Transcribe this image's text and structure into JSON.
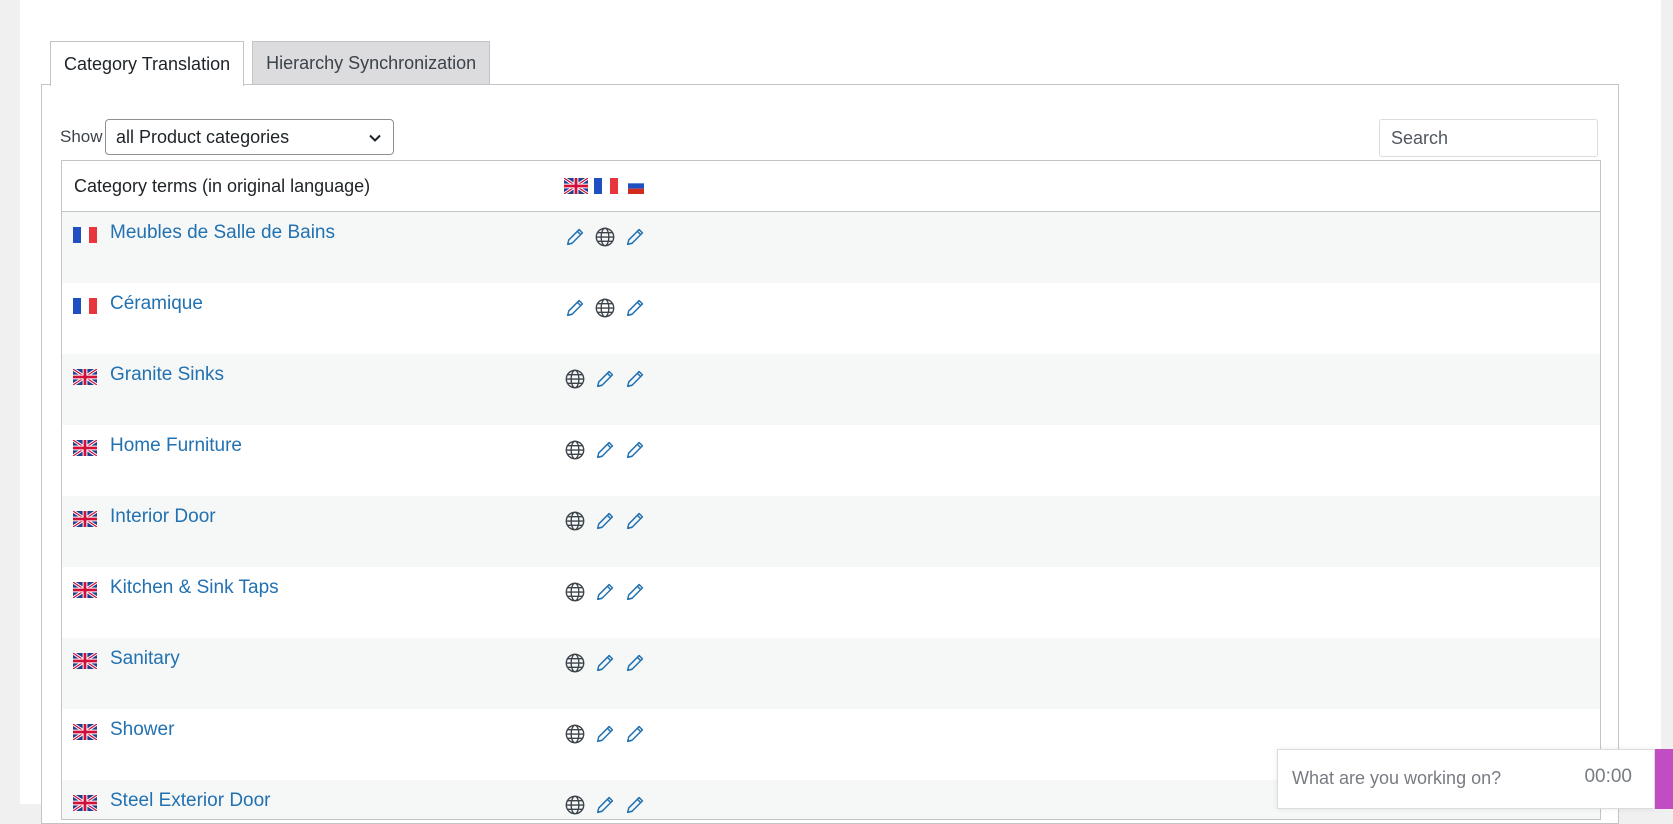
{
  "tabs": [
    {
      "label": "Category Translation",
      "active": true
    },
    {
      "label": "Hierarchy Synchronization",
      "active": false
    }
  ],
  "filter": {
    "show_label": "Show",
    "selected_option": "all Product categories",
    "search_placeholder": "Search"
  },
  "table": {
    "header": "Category terms (in original language)",
    "language_flags": [
      "gb-flag-icon",
      "fr-flag-icon",
      "ru-flag-icon"
    ],
    "rows": [
      {
        "name": "Meubles de Salle de Bains",
        "flag": "fr",
        "actions": [
          "pencil",
          "globe",
          "pencil"
        ]
      },
      {
        "name": "Céramique",
        "flag": "fr",
        "actions": [
          "pencil",
          "globe",
          "pencil"
        ]
      },
      {
        "name": "Granite Sinks",
        "flag": "gb",
        "actions": [
          "globe",
          "pencil",
          "pencil"
        ]
      },
      {
        "name": "Home Furniture",
        "flag": "gb",
        "actions": [
          "globe",
          "pencil",
          "pencil"
        ]
      },
      {
        "name": "Interior Door",
        "flag": "gb",
        "actions": [
          "globe",
          "pencil",
          "pencil"
        ]
      },
      {
        "name": "Kitchen & Sink Taps",
        "flag": "gb",
        "actions": [
          "globe",
          "pencil",
          "pencil"
        ]
      },
      {
        "name": "Sanitary",
        "flag": "gb",
        "actions": [
          "globe",
          "pencil",
          "pencil"
        ]
      },
      {
        "name": "Shower",
        "flag": "gb",
        "actions": [
          "globe",
          "pencil",
          "pencil"
        ]
      },
      {
        "name": "Steel Exterior Door",
        "flag": "gb",
        "actions": [
          "globe",
          "pencil",
          "pencil"
        ]
      }
    ]
  },
  "timer": {
    "placeholder": "What are you working on?",
    "time": "00:00",
    "accent": "#c04dc1"
  },
  "colors": {
    "link": "#2271b1",
    "alt_row": "#f6f7f7",
    "border": "#c3c4c7"
  }
}
